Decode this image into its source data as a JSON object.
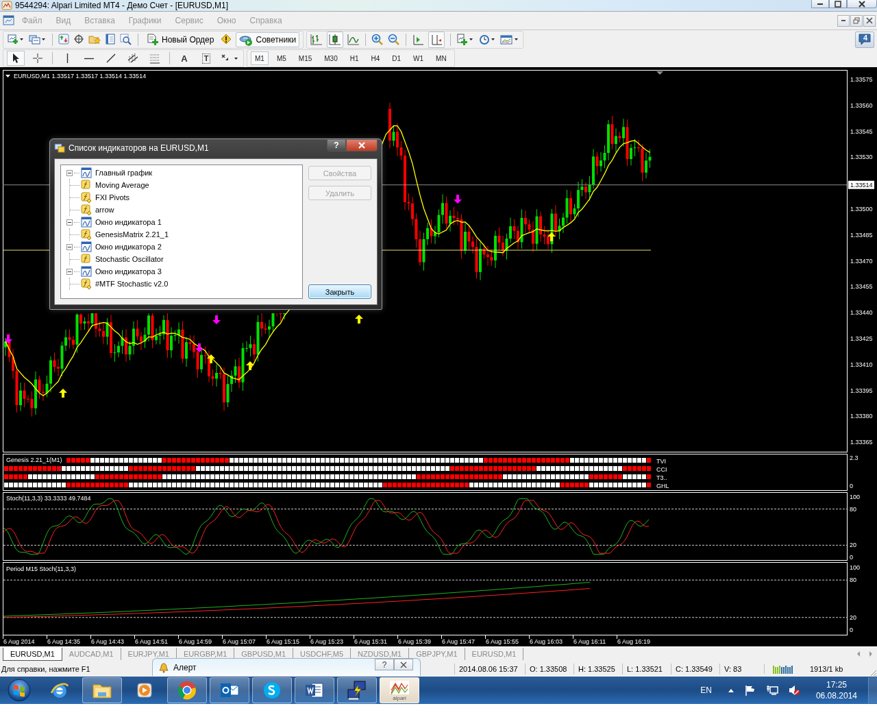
{
  "window": {
    "title": "9544294: Alpari Limited MT4 - Демо Счет - [EURUSD,M1]"
  },
  "menu": [
    {
      "label": "Файл",
      "disabled": true
    },
    {
      "label": "Вид",
      "disabled": true
    },
    {
      "label": "Вставка",
      "disabled": true
    },
    {
      "label": "Графики",
      "disabled": true
    },
    {
      "label": "Сервис",
      "disabled": true
    },
    {
      "label": "Окно",
      "disabled": true
    },
    {
      "label": "Справка",
      "disabled": true
    }
  ],
  "toolbar": {
    "new_order": "Новый Ордер",
    "experts": {
      "label": "Советники",
      "on": true
    },
    "messages_count": "4"
  },
  "drawing_tools": [
    {
      "kind": "cursor",
      "selected": true
    },
    {
      "kind": "crosshair",
      "selected": false
    },
    {
      "kind": "vline",
      "selected": false
    },
    {
      "kind": "hline",
      "selected": false
    },
    {
      "kind": "trendline",
      "selected": false
    },
    {
      "kind": "channel",
      "selected": false
    },
    {
      "kind": "fibo",
      "selected": false
    },
    {
      "kind": "text",
      "glyph": "A",
      "selected": false
    },
    {
      "kind": "label",
      "glyph": "T",
      "selected": false
    },
    {
      "kind": "arrows",
      "selected": false
    }
  ],
  "timeframes": [
    {
      "label": "M1",
      "selected": true
    },
    {
      "label": "M5",
      "selected": false
    },
    {
      "label": "M15",
      "selected": false
    },
    {
      "label": "M30",
      "selected": false
    },
    {
      "label": "H1",
      "selected": false
    },
    {
      "label": "H4",
      "selected": false
    },
    {
      "label": "D1",
      "selected": false
    },
    {
      "label": "W1",
      "selected": false
    },
    {
      "label": "MN",
      "selected": false
    }
  ],
  "chart": {
    "header": "EURUSD,M1  1.33517 1.33517 1.33514 1.33514",
    "price_axis": [
      "1.33575",
      "1.33560",
      "1.33545",
      "1.33530",
      "1.33500",
      "1.33485",
      "1.33470",
      "1.33455",
      "1.33440",
      "1.33425",
      "1.33410",
      "1.33395",
      "1.33380",
      "1.33365"
    ],
    "current_price": "1.33514",
    "time_axis": [
      "6 Aug 2014",
      "6 Aug 14:35",
      "6 Aug 14:43",
      "6 Aug 14:51",
      "6 Aug 14:59",
      "6 Aug 15:07",
      "6 Aug 15:15",
      "6 Aug 15:23",
      "6 Aug 15:31",
      "6 Aug 15:39",
      "6 Aug 15:47",
      "6 Aug 15:55",
      "6 Aug 16:03",
      "6 Aug 16:11",
      "6 Aug 16:19"
    ],
    "indicators": [
      {
        "kind": "matrix",
        "title": "Genesis 2.21_1(M1)",
        "rows": [
          "TVI",
          "CCI",
          "T3..",
          "GHL"
        ],
        "scale": [
          "2.3",
          "0"
        ]
      },
      {
        "kind": "oscillator",
        "title": "Stoch(11,3,3) 33.3333 49.7484",
        "scale": [
          "100",
          "80",
          "20",
          "0"
        ]
      },
      {
        "kind": "trend",
        "title": "Period M15 Stoch(11,3,3)",
        "scale": [
          "100",
          "80",
          "20",
          "0"
        ]
      }
    ]
  },
  "dialog": {
    "title": "Список индикаторов на EURUSD,M1",
    "help_glyph": "?",
    "tree": [
      {
        "label": "Главный график",
        "kind": "window",
        "expanded": true,
        "children": [
          {
            "label": "Moving Average",
            "kind": "builtin"
          },
          {
            "label": "FXI Pivots",
            "kind": "custom"
          },
          {
            "label": "arrow",
            "kind": "custom"
          }
        ]
      },
      {
        "label": "Окно индикатора 1",
        "kind": "window",
        "expanded": true,
        "children": [
          {
            "label": "GenesisMatrix 2.21_1",
            "kind": "custom"
          }
        ]
      },
      {
        "label": "Окно индикатора 2",
        "kind": "window",
        "expanded": true,
        "children": [
          {
            "label": "Stochastic Oscillator",
            "kind": "builtin"
          }
        ]
      },
      {
        "label": "Окно индикатора 3",
        "kind": "window",
        "expanded": true,
        "children": [
          {
            "label": "#MTF Stochastic v2.0",
            "kind": "custom"
          }
        ]
      }
    ],
    "buttons": [
      {
        "label": "Свойства",
        "disabled": true,
        "default": false
      },
      {
        "label": "Удалить",
        "disabled": true,
        "default": false
      },
      {
        "label": "Закрыть",
        "disabled": false,
        "default": true
      }
    ]
  },
  "tabs": [
    {
      "label": "EURUSD,M1",
      "selected": true
    },
    {
      "label": "AUDCAD,M1",
      "selected": false
    },
    {
      "label": "EURJPY,M1",
      "selected": false
    },
    {
      "label": "EURGBP,M1",
      "selected": false
    },
    {
      "label": "GBPUSD,M1",
      "selected": false
    },
    {
      "label": "USDCHF,M5",
      "selected": false
    },
    {
      "label": "NZDUSD,M1",
      "selected": false
    },
    {
      "label": "GBPJPY,M1",
      "selected": false
    },
    {
      "label": "EURUSD,M1",
      "selected": false
    }
  ],
  "status_bar": {
    "help": "Для справки, нажмите F1",
    "fields": [
      "2014.08.06 15:37",
      "O: 1.33508",
      "H: 1.33525",
      "L: 1.33521",
      "C: 1.33549",
      "V: 83"
    ],
    "traffic": "1913/1 kb"
  },
  "alert": {
    "title": "Алерт",
    "help_glyph": "?"
  },
  "taskbar": {
    "apps": [
      {
        "kind": "browser-e",
        "open": false
      },
      {
        "kind": "folder",
        "open": true
      },
      {
        "kind": "player",
        "open": false
      },
      {
        "kind": "browser-circle",
        "open": true
      },
      {
        "kind": "mail",
        "open": true
      },
      {
        "kind": "chat",
        "open": true
      },
      {
        "kind": "document",
        "open": true
      },
      {
        "kind": "network",
        "open": true
      },
      {
        "kind": "alpari",
        "label": "alpari",
        "open": true
      }
    ],
    "language": "EN",
    "time": "17:25",
    "date": "06.08.2014"
  }
}
